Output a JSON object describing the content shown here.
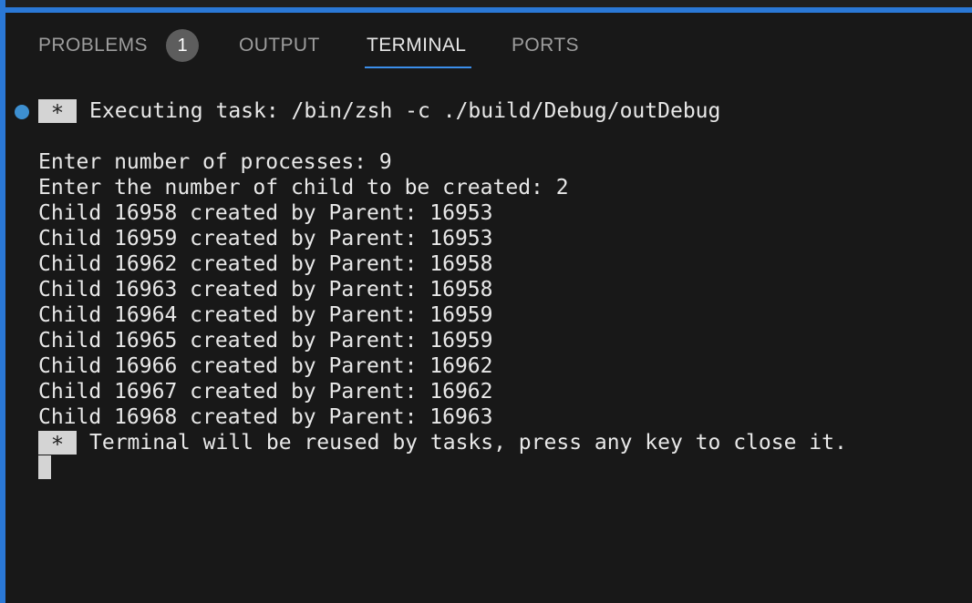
{
  "tabs": {
    "problems": "PROBLEMS",
    "problems_count": "1",
    "output": "OUTPUT",
    "terminal": "TERMINAL",
    "ports": "PORTS"
  },
  "terminal": {
    "task_marker": "*",
    "task_line": "Executing task: /bin/zsh -c ./build/Debug/outDebug",
    "output_lines": [
      "Enter number of processes: 9",
      "Enter the number of child to be created: 2",
      "Child 16958 created by Parent: 16953",
      "Child 16959 created by Parent: 16953",
      "Child 16962 created by Parent: 16958",
      "Child 16963 created by Parent: 16958",
      "Child 16964 created by Parent: 16959",
      "Child 16965 created by Parent: 16959",
      "Child 16966 created by Parent: 16962",
      "Child 16967 created by Parent: 16962",
      "Child 16968 created by Parent: 16963"
    ],
    "end_marker": "*",
    "end_line": "Terminal will be reused by tasks, press any key to close it."
  },
  "colors": {
    "accent": "#2a78d6",
    "background": "#181818",
    "active_tab_underline": "#3b8eea",
    "status_dot": "#3d8fd0"
  }
}
